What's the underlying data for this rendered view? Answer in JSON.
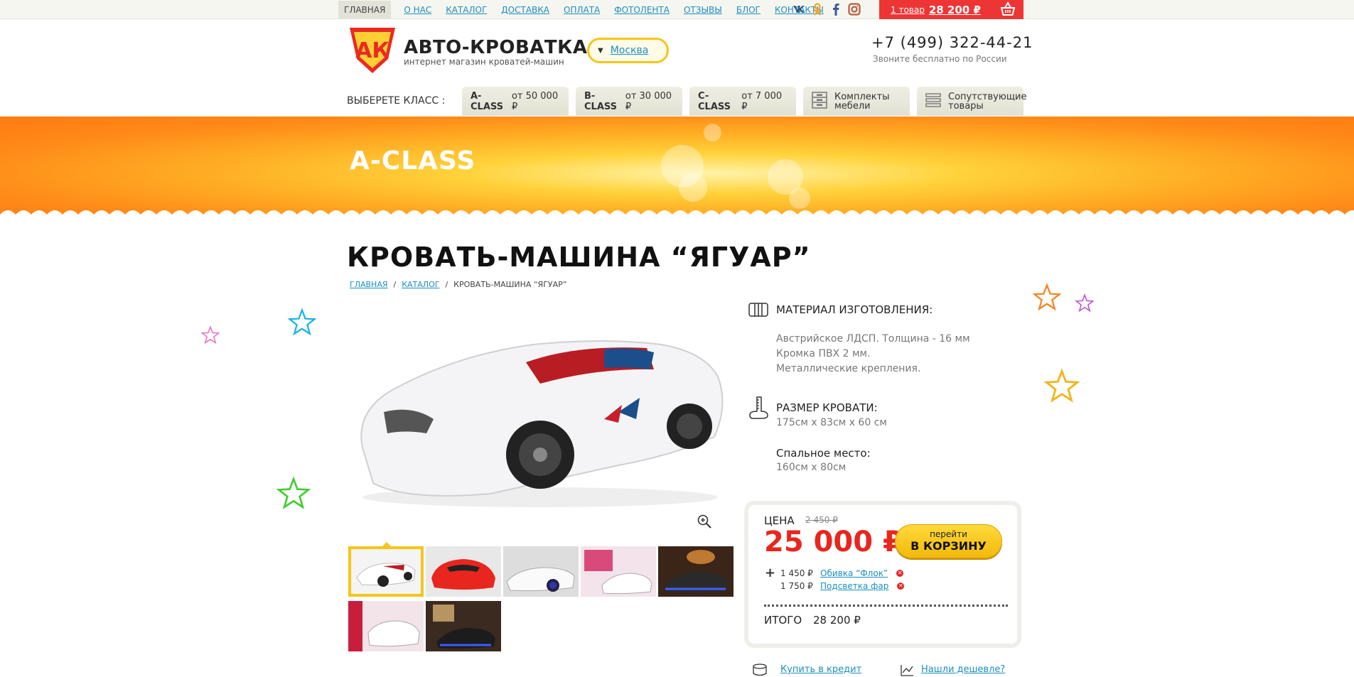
{
  "nav": {
    "items": [
      "ГЛАВНАЯ",
      "О НАС",
      "КАТАЛОГ",
      "ДОСТАВКА",
      "ОПЛАТА",
      "ФОТОЛЕНТА",
      "ОТЗЫВЫ",
      "БЛОГ",
      "КОНТАКТЫ"
    ],
    "active": "ГЛАВНАЯ",
    "social": [
      "vk-icon",
      "odnoklassniki-icon",
      "facebook-icon",
      "instagram-icon"
    ]
  },
  "cart": {
    "count_label": "1 товар",
    "sum": "28 200 ₽",
    "icon": "basket-icon"
  },
  "header": {
    "brand": "АВТО-КРОВАТКА",
    "tagline": "интернет магазин  кроватей-машин",
    "logo_letters": "АК",
    "city": "Москва",
    "phone": "+7 (499) 322-44-21",
    "phone_note": "Звоните бесплатно по России"
  },
  "classes": {
    "label": "ВЫБЕРЕТЕ КЛАСС :",
    "tabs": [
      {
        "name": "A-CLASS",
        "price": "от 50 000 ₽"
      },
      {
        "name": "B-CLASS",
        "price": "от 30 000 ₽"
      },
      {
        "name": "C-CLASS",
        "price": "от 7 000 ₽"
      }
    ],
    "extra": [
      {
        "line1": "Комплекты",
        "line2": "мебели",
        "icon": "dresser-icon"
      },
      {
        "line1": "Сопутствующие",
        "line2": "товары",
        "icon": "list-icon"
      }
    ]
  },
  "banner": {
    "title": "A-CLASS"
  },
  "product": {
    "title": "КРОВАТЬ-МАШИНА “ЯГУАР”",
    "breadcrumb": [
      "ГЛАВНАЯ",
      "КАТАЛОГ",
      "КРОВАТЬ-МАШИНА “ЯГУАР”"
    ],
    "thumb_count": 7
  },
  "specs": {
    "material_head": "МАТЕРИАЛ ИЗГОТОВЛЕНИЯ:",
    "material_lines": [
      "Австрийское  ЛДСП. Толщина - 16 мм",
      "Кромка ПВХ 2 мм.",
      "Металлические крепления."
    ],
    "size_head": "РАЗМЕР КРОВАТИ:",
    "size_value": "175см х 83см х 60 см",
    "sleep_head": "Спальное место:",
    "sleep_value": "160см х 80см"
  },
  "price": {
    "label": "ЦЕНА",
    "old": "2 450 ₽",
    "main": "25 000 ₽",
    "btn_line1": "перейти",
    "btn_line2": "В КОРЗИНУ",
    "options": [
      {
        "price": "1 450 ₽",
        "name": "Обивка  “Флок”"
      },
      {
        "price": "1 750 ₽",
        "name": "Подсветка фар"
      }
    ],
    "total_label": "ИТОГО",
    "total": "28 200 ₽"
  },
  "bottom_links": {
    "credit": "Купить в кредит",
    "cheaper": "Нашли дешевле?"
  }
}
